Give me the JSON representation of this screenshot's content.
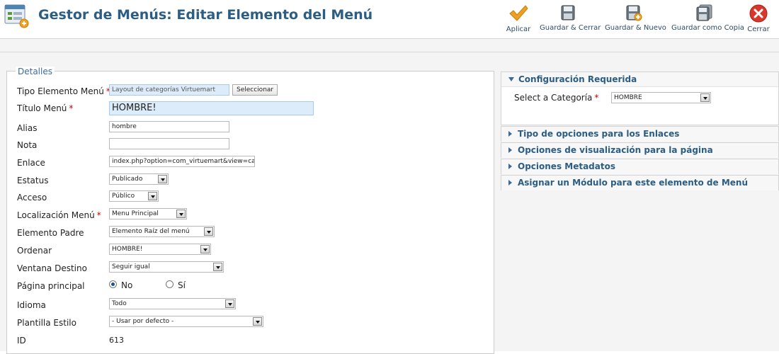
{
  "header": {
    "title": "Gestor de Menús: Editar Elemento del Menú",
    "icon": "menu-manager-icon"
  },
  "toolbar": [
    {
      "label": "Aplicar",
      "icon": "checkmark-icon",
      "color": "#f0a020"
    },
    {
      "label": "Guardar & Cerrar",
      "icon": "floppy-disk-icon"
    },
    {
      "label": "Guardar & Nuevo",
      "icon": "floppy-disk-plus-icon"
    },
    {
      "label": "Guardar como Copia",
      "icon": "floppy-disk-copy-icon"
    },
    {
      "label": "Cerrar",
      "icon": "close-icon",
      "color": "#d9372b"
    }
  ],
  "details": {
    "legend": "Detalles",
    "required_marker": "*",
    "fields": {
      "tipo": {
        "label": "Tipo Elemento Menú",
        "value": "Layout de categorías Virtuemart",
        "button": "Seleccionar"
      },
      "titulo": {
        "label": "Título Menú",
        "value": "HOMBRE!"
      },
      "alias": {
        "label": "Alias",
        "value": "hombre"
      },
      "nota": {
        "label": "Nota",
        "value": ""
      },
      "enlace": {
        "label": "Enlace",
        "value": "index.php?option=com_virtuemart&view=categ"
      },
      "estatus": {
        "label": "Estatus",
        "value": "Publicado"
      },
      "acceso": {
        "label": "Acceso",
        "value": "Público"
      },
      "localizacion": {
        "label": "Localización Menú",
        "value": "Menu Principal"
      },
      "padre": {
        "label": "Elemento Padre",
        "value": "Elemento Raíz del menú"
      },
      "ordenar": {
        "label": "Ordenar",
        "value": "HOMBRE!"
      },
      "ventana": {
        "label": "Ventana Destino",
        "value": "Seguir igual"
      },
      "principal": {
        "label": "Página principal",
        "options": [
          "No",
          "Sí"
        ],
        "selected": "No"
      },
      "idioma": {
        "label": "Idioma",
        "value": "Todo"
      },
      "plantilla": {
        "label": "Plantilla Estilo",
        "value": "- Usar por defecto -"
      },
      "id": {
        "label": "ID",
        "value": "613"
      }
    }
  },
  "panels": {
    "required": {
      "title": "Configuración Requerida",
      "field_label": "Select a Categoría",
      "field_value": "HOMBRE"
    },
    "collapsed": [
      "Tipo de opciones para los Enlaces",
      "Opciones de visualización para la página",
      "Opciones Metadatos",
      "Asignar un Módulo para este elemento de Menú"
    ]
  },
  "colors": {
    "title": "#2c5d84",
    "required": "#cc0000",
    "readonly_bg": "#dcecfa"
  }
}
